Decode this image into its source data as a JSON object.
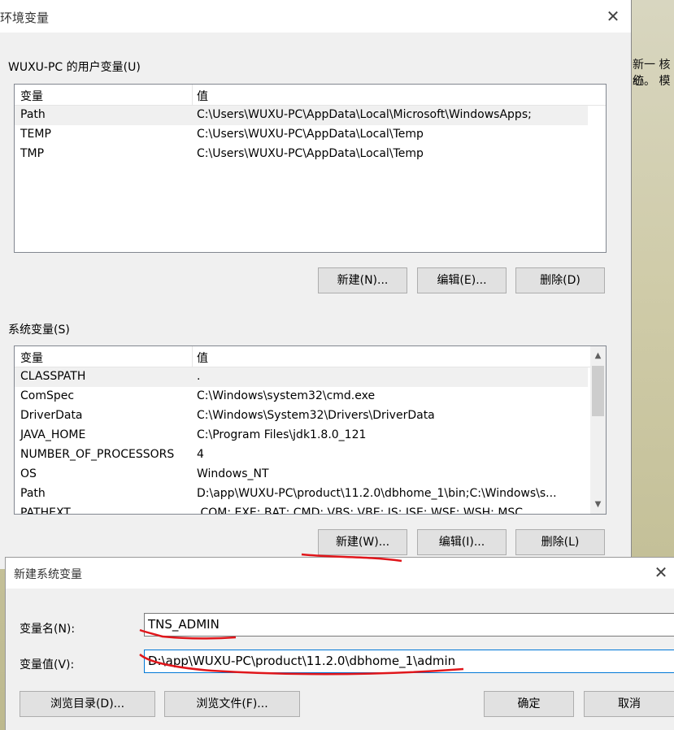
{
  "desktop": {
    "line1": "新一  核心",
    "line2": "统。  模"
  },
  "main_window": {
    "title": "环境变量",
    "user_group_label": "WUXU-PC 的用户变量(U)",
    "user_vars": {
      "headers": [
        "变量",
        "值"
      ],
      "rows": [
        {
          "name": "Path",
          "value": "C:\\Users\\WUXU-PC\\AppData\\Local\\Microsoft\\WindowsApps;"
        },
        {
          "name": "TEMP",
          "value": "C:\\Users\\WUXU-PC\\AppData\\Local\\Temp"
        },
        {
          "name": "TMP",
          "value": "C:\\Users\\WUXU-PC\\AppData\\Local\\Temp"
        }
      ]
    },
    "user_buttons": {
      "new": "新建(N)...",
      "edit": "编辑(E)...",
      "delete": "删除(D)"
    },
    "system_group_label": "系统变量(S)",
    "system_vars": {
      "headers": [
        "变量",
        "值"
      ],
      "rows": [
        {
          "name": "CLASSPATH",
          "value": "."
        },
        {
          "name": "ComSpec",
          "value": "C:\\Windows\\system32\\cmd.exe"
        },
        {
          "name": "DriverData",
          "value": "C:\\Windows\\System32\\Drivers\\DriverData"
        },
        {
          "name": "JAVA_HOME",
          "value": "C:\\Program Files\\jdk1.8.0_121"
        },
        {
          "name": "NUMBER_OF_PROCESSORS",
          "value": "4"
        },
        {
          "name": "OS",
          "value": "Windows_NT"
        },
        {
          "name": "Path",
          "value": "D:\\app\\WUXU-PC\\product\\11.2.0\\dbhome_1\\bin;C:\\Windows\\s..."
        },
        {
          "name": "PATHEXT",
          "value": ".COM;.EXE;.BAT;.CMD;.VBS;.VBE;.JS;.JSE;.WSF;.WSH;.MSC"
        }
      ]
    },
    "system_buttons": {
      "new": "新建(W)...",
      "edit": "编辑(I)...",
      "delete": "删除(L)"
    }
  },
  "new_var_dialog": {
    "title": "新建系统变量",
    "name_label": "变量名(N):",
    "name_value": "TNS_ADMIN",
    "value_label": "变量值(V):",
    "value_value": "D:\\app\\WUXU-PC\\product\\11.2.0\\dbhome_1\\admin",
    "browse_dir": "浏览目录(D)...",
    "browse_file": "浏览文件(F)...",
    "ok": "确定",
    "cancel": "取消"
  },
  "colors": {
    "annotation": "#e0161b",
    "focus_border": "#0078d7"
  }
}
